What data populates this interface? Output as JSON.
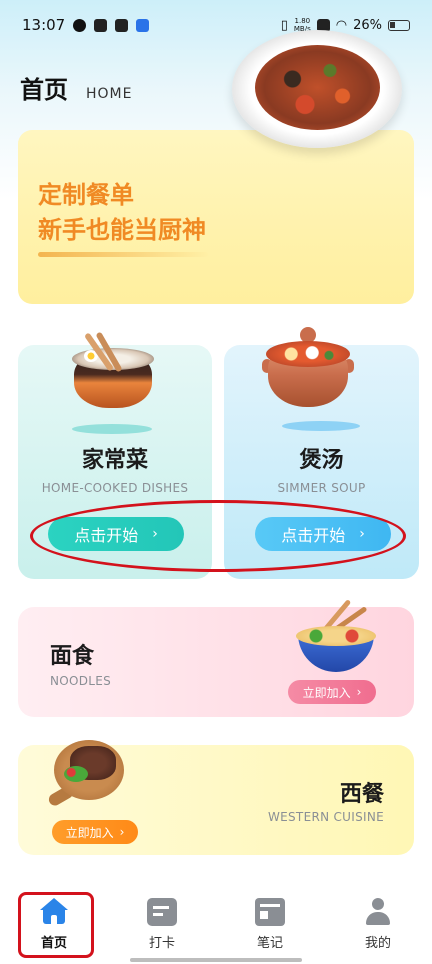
{
  "status_bar": {
    "time": "13:07",
    "net_speed_value": "1.80",
    "net_speed_unit": "MB/s",
    "battery": "26%"
  },
  "header": {
    "title": "首页",
    "subtitle": "HOME"
  },
  "banner": {
    "line1": "定制餐单",
    "line2": "新手也能当厨神"
  },
  "categories": [
    {
      "title": "家常菜",
      "subtitle": "HOME-COOKED DISHES",
      "button": "点击开始",
      "color": "#23c6b8"
    },
    {
      "title": "煲汤",
      "subtitle": "SIMMER SOUP",
      "button": "点击开始",
      "color": "#3fb7f2"
    }
  ],
  "noodles": {
    "title": "面食",
    "subtitle": "NOODLES",
    "button": "立即加入",
    "color": "#f06d8f"
  },
  "western": {
    "title": "西餐",
    "subtitle": "WESTERN CUISINE",
    "button": "立即加入",
    "color": "#ff8a18"
  },
  "tabs": [
    {
      "label": "首页",
      "icon": "home-icon",
      "active": true
    },
    {
      "label": "打卡",
      "icon": "checkin-icon",
      "active": false
    },
    {
      "label": "笔记",
      "icon": "notes-icon",
      "active": false
    },
    {
      "label": "我的",
      "icon": "profile-icon",
      "active": false
    }
  ],
  "colors": {
    "accent": "#2a84e8",
    "annotation": "#d3121c"
  }
}
